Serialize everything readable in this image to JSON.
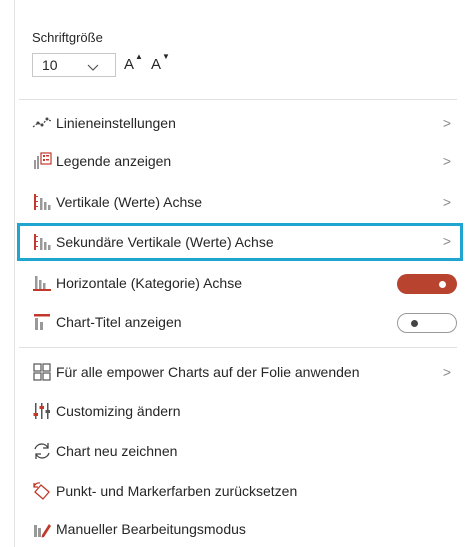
{
  "font": {
    "label": "Schriftgröße",
    "size_value": "10",
    "grow_label": "A",
    "shrink_label": "A"
  },
  "menu": {
    "items": [
      {
        "label": "Linieneinstellungen",
        "icon": "line-settings-icon",
        "control": "submenu"
      },
      {
        "label": "Legende anzeigen",
        "icon": "legend-icon",
        "control": "submenu"
      },
      {
        "label": "Vertikale (Werte) Achse",
        "icon": "vertical-axis-icon",
        "control": "submenu"
      },
      {
        "label": "Sekundäre Vertikale (Werte) Achse",
        "icon": "secondary-vertical-axis-icon",
        "control": "submenu",
        "selected": true
      },
      {
        "label": "Horizontale (Kategorie) Achse",
        "icon": "horizontal-axis-icon",
        "control": "toggle",
        "toggle_state": "on"
      },
      {
        "label": "Chart-Titel anzeigen",
        "icon": "chart-title-icon",
        "control": "toggle",
        "toggle_state": "off"
      },
      {
        "label": "Für alle empower Charts auf der Folie anwenden",
        "icon": "apply-all-charts-icon",
        "control": "submenu"
      },
      {
        "label": "Customizing ändern",
        "icon": "customizing-icon",
        "control": "none"
      },
      {
        "label": "Chart neu zeichnen",
        "icon": "redraw-icon",
        "control": "none"
      },
      {
        "label": "Punkt- und Markerfarben zurücksetzen",
        "icon": "reset-colors-icon",
        "control": "none"
      },
      {
        "label": "Manueller Bearbeitungsmodus",
        "icon": "manual-edit-icon",
        "control": "none"
      }
    ]
  },
  "colors": {
    "selection_border": "#1fa6d0",
    "toggle_on": "#b8442f",
    "icon_accent": "#c0392b"
  }
}
